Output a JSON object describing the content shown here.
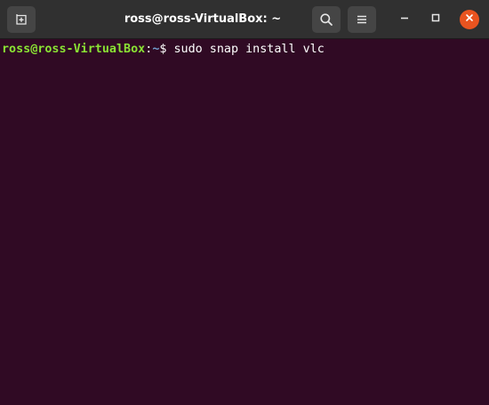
{
  "window": {
    "title": "ross@ross-VirtualBox: ~"
  },
  "toolbar": {
    "new_tab_icon": "new-tab-icon",
    "search_icon": "search-icon",
    "menu_icon": "hamburger-menu-icon"
  },
  "window_controls": {
    "minimize_icon": "minimize-icon",
    "maximize_icon": "maximize-icon",
    "close_icon": "close-icon"
  },
  "terminal": {
    "prompt_user_host": "ross@ross-VirtualBox",
    "prompt_separator": ":",
    "prompt_path": "~",
    "prompt_symbol": "$ ",
    "command": "sudo snap install vlc"
  },
  "colors": {
    "terminal_background": "#300a24",
    "titlebar_background": "#303030",
    "prompt_user_color": "#8ae234",
    "prompt_path_color": "#729fcf",
    "close_button_color": "#e95420"
  }
}
